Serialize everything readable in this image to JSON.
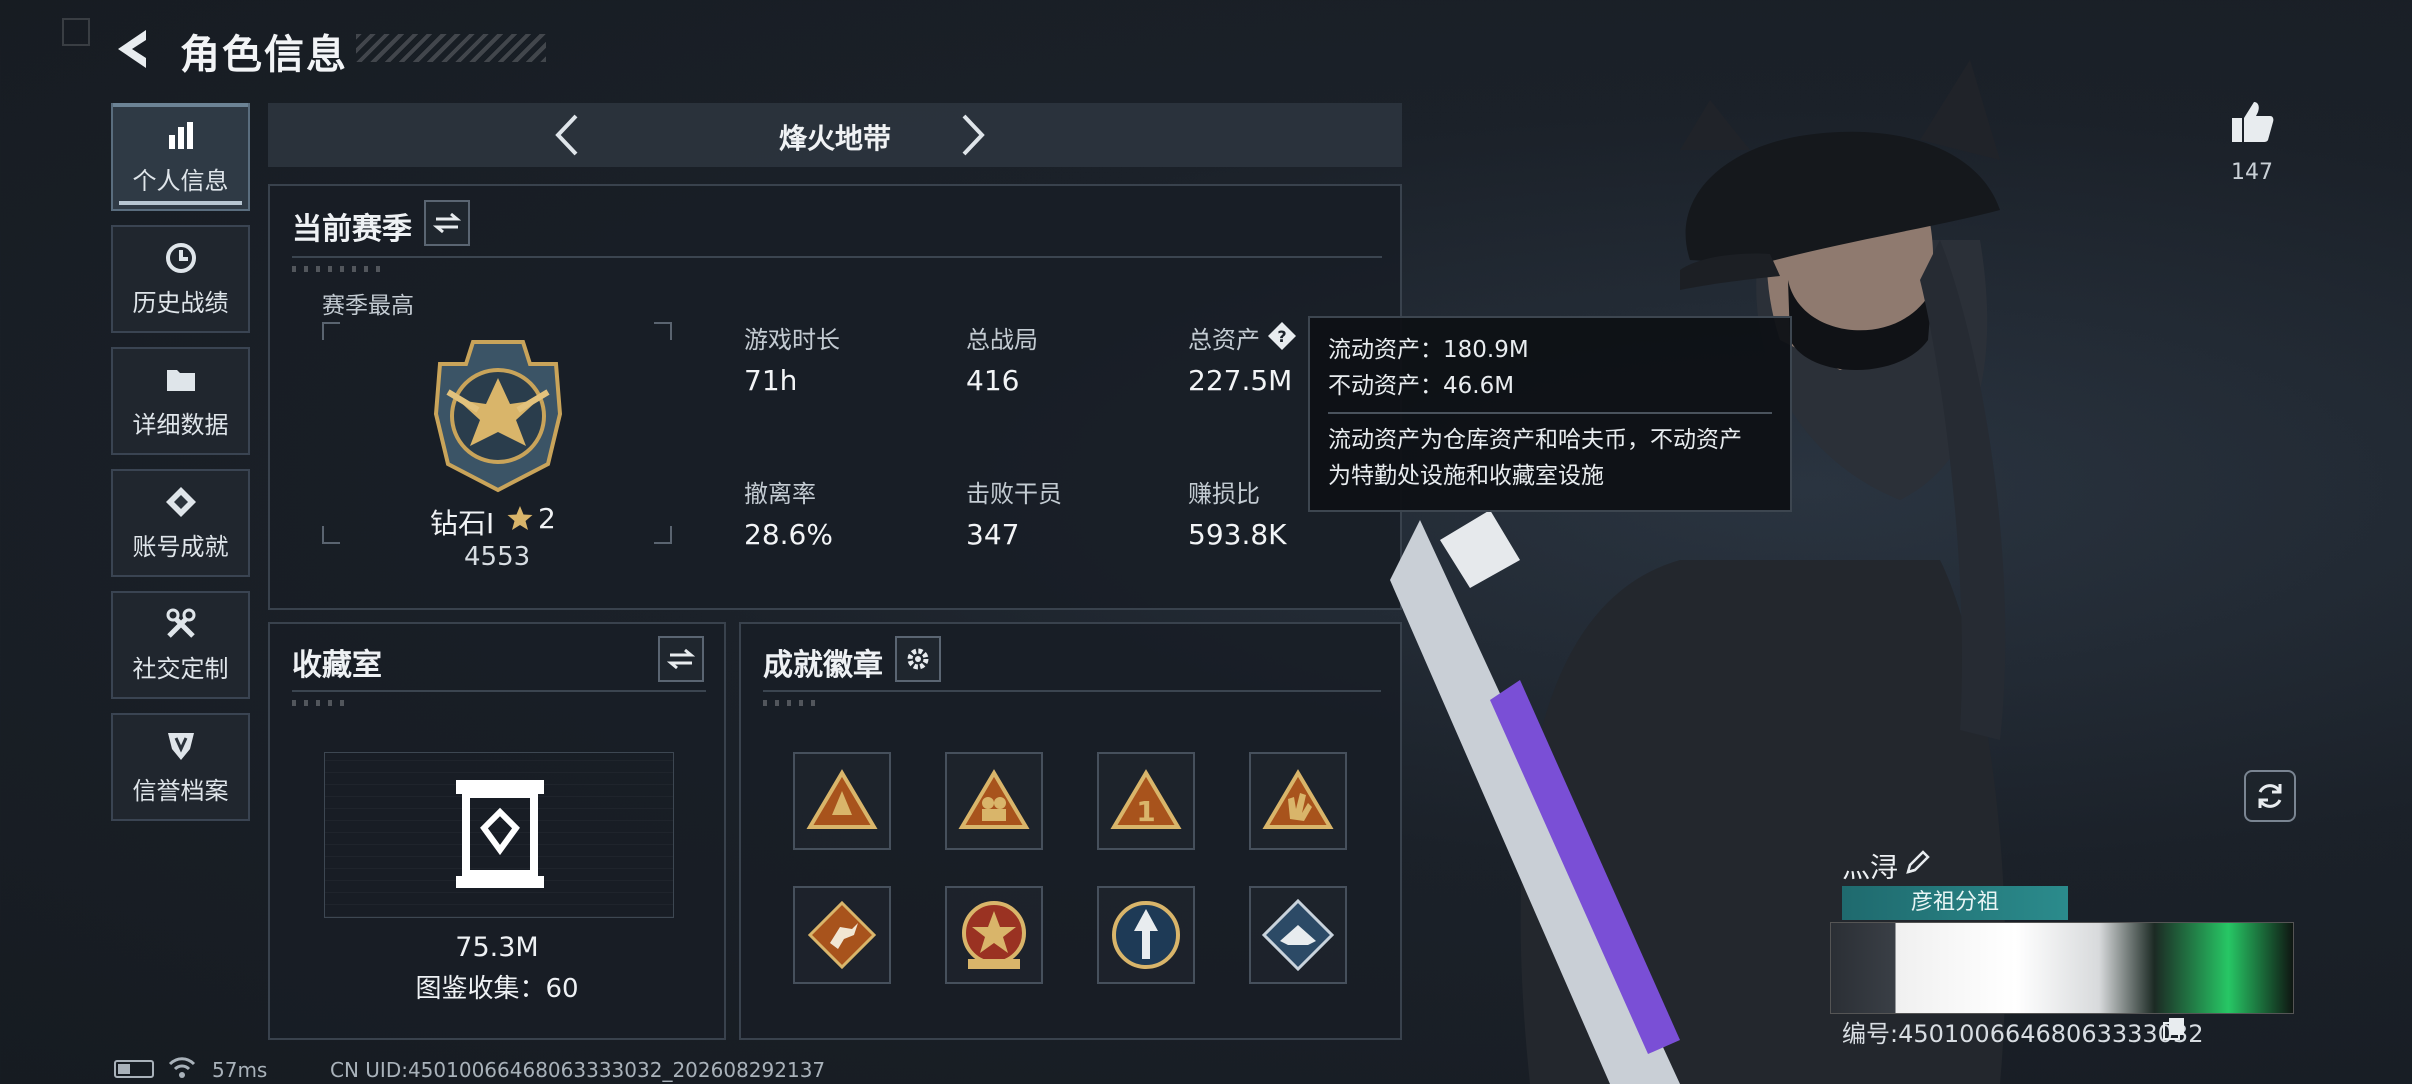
{
  "header": {
    "title": "角色信息"
  },
  "nav": [
    {
      "label": "个人信息",
      "icon": "bar-chart-icon",
      "active": true
    },
    {
      "label": "历史战绩",
      "icon": "history-icon",
      "active": false
    },
    {
      "label": "详细数据",
      "icon": "folder-icon",
      "active": false
    },
    {
      "label": "账号成就",
      "icon": "achievement-icon",
      "active": false
    },
    {
      "label": "社交定制",
      "icon": "tools-icon",
      "active": false
    },
    {
      "label": "信誉档案",
      "icon": "shield-icon",
      "active": false
    }
  ],
  "mode_bar": {
    "title": "烽火地带"
  },
  "season": {
    "title": "当前赛季",
    "best_label": "赛季最高",
    "rank_name": "钻石Ⅰ",
    "rank_stars": "2",
    "rank_score": "4553",
    "stats": [
      {
        "label": "游戏时长",
        "value": "71h"
      },
      {
        "label": "总战局",
        "value": "416"
      },
      {
        "label": "总资产",
        "value": "227.5M"
      },
      {
        "label": "撤离率",
        "value": "28.6%"
      },
      {
        "label": "击败干员",
        "value": "347"
      },
      {
        "label": "赚损比",
        "value": "593.8K"
      }
    ]
  },
  "tooltip": {
    "liquid": "流动资产：180.9M",
    "fixed": "不动资产：46.6M",
    "desc_line1": "流动资产为仓库资产和哈夫币，不动资产",
    "desc_line2": "为特勤处设施和收藏室设施"
  },
  "collection": {
    "title": "收藏室",
    "value": "75.3M",
    "codex": "图鉴收集：60"
  },
  "badges": {
    "title": "成就徽章",
    "items": [
      "badge-1",
      "badge-2",
      "badge-3",
      "badge-4",
      "badge-5",
      "badge-6",
      "badge-7",
      "badge-8"
    ]
  },
  "social": {
    "like_count": "147"
  },
  "card": {
    "name": "灬浔",
    "tag": "彦祖分祖",
    "id": "编号:45010066468063333032"
  },
  "status_bar": {
    "ping": "57ms",
    "uid": "CN UID:45010066468063333032_202608292137"
  },
  "colors": {
    "accent_teal": "#2b8b8c",
    "gold": "#c9a45a",
    "panel_border": "#39424d"
  }
}
